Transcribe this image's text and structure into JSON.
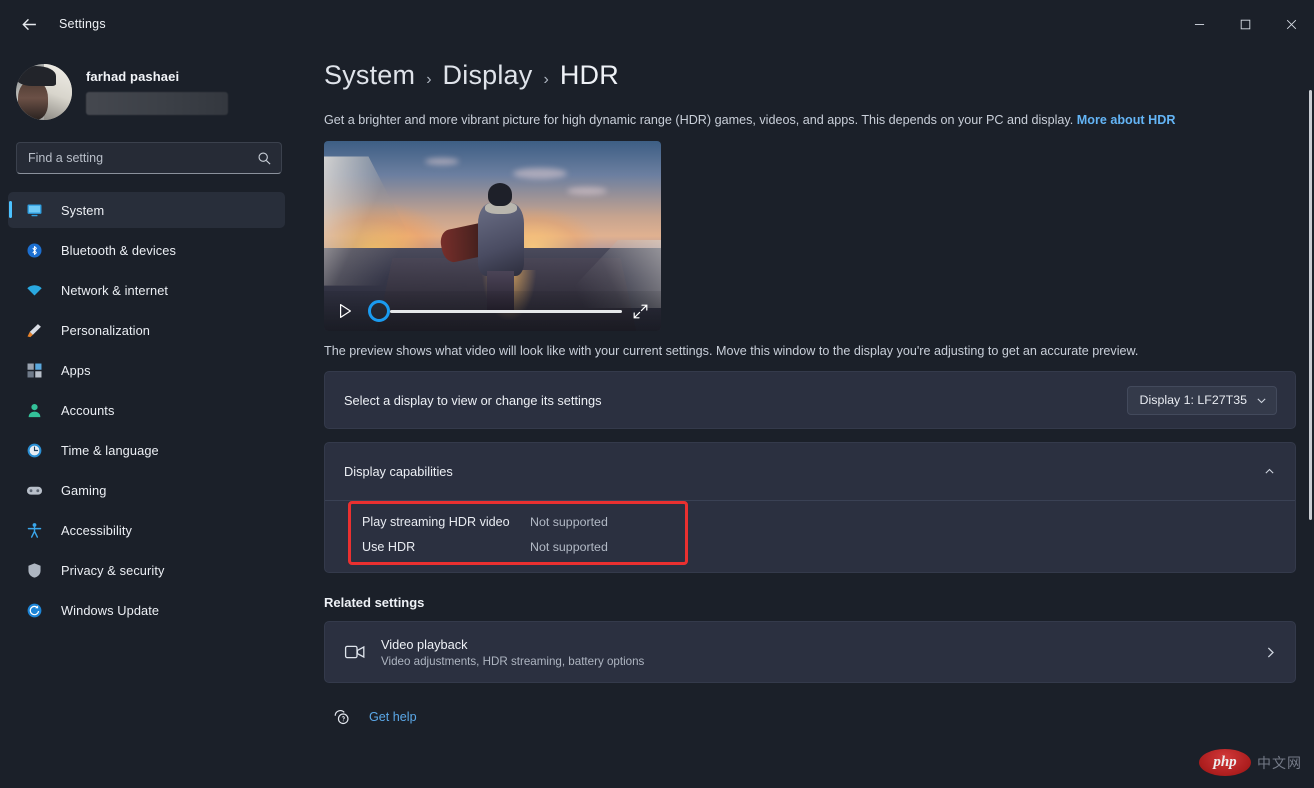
{
  "window": {
    "title": "Settings",
    "back_label": "Back",
    "minimize_label": "Minimize",
    "maximize_label": "Maximize",
    "close_label": "Close"
  },
  "account": {
    "name": "farhad pashaei",
    "email_redacted": ""
  },
  "search": {
    "placeholder": "Find a setting",
    "value": ""
  },
  "sidebar": {
    "items": [
      {
        "label": "System",
        "icon": "monitor-icon",
        "selected": true
      },
      {
        "label": "Bluetooth & devices",
        "icon": "bluetooth-icon",
        "selected": false
      },
      {
        "label": "Network & internet",
        "icon": "wifi-icon",
        "selected": false
      },
      {
        "label": "Personalization",
        "icon": "paintbrush-icon",
        "selected": false
      },
      {
        "label": "Apps",
        "icon": "apps-icon",
        "selected": false
      },
      {
        "label": "Accounts",
        "icon": "person-icon",
        "selected": false
      },
      {
        "label": "Time & language",
        "icon": "clock-icon",
        "selected": false
      },
      {
        "label": "Gaming",
        "icon": "gamepad-icon",
        "selected": false
      },
      {
        "label": "Accessibility",
        "icon": "accessibility-icon",
        "selected": false
      },
      {
        "label": "Privacy & security",
        "icon": "shield-icon",
        "selected": false
      },
      {
        "label": "Windows Update",
        "icon": "update-icon",
        "selected": false
      }
    ]
  },
  "breadcrumb": {
    "parts": [
      "System",
      "Display",
      "HDR"
    ],
    "separator": "›"
  },
  "description": {
    "text": "Get a brighter and more vibrant picture for high dynamic range (HDR) games, videos, and apps. This depends on your PC and display. ",
    "link": "More about HDR"
  },
  "preview": {
    "caption": "The preview shows what video will look like with your current settings. Move this window to the display you're adjusting to get an accurate preview.",
    "play_label": "Play",
    "expand_label": "Full screen"
  },
  "display_select": {
    "label": "Select a display to view or change its settings",
    "selected": "Display 1: LF27T35"
  },
  "display_capabilities": {
    "title": "Display capabilities",
    "expanded": true,
    "rows": [
      {
        "name": "Play streaming HDR video",
        "value": "Not supported"
      },
      {
        "name": "Use HDR",
        "value": "Not supported"
      }
    ],
    "highlight_color": "#ea3030"
  },
  "related": {
    "title": "Related settings",
    "items": [
      {
        "title": "Video playback",
        "subtitle": "Video adjustments, HDR streaming, battery options",
        "icon": "video-icon"
      }
    ]
  },
  "footer": {
    "get_help": "Get help"
  },
  "watermark": {
    "logo": "php",
    "text": "中文网"
  },
  "colors": {
    "accent": "#4cc2ff",
    "link": "#64b5f6",
    "card": "#2b3040",
    "background": "#1b2029",
    "highlight": "#ea3030"
  }
}
